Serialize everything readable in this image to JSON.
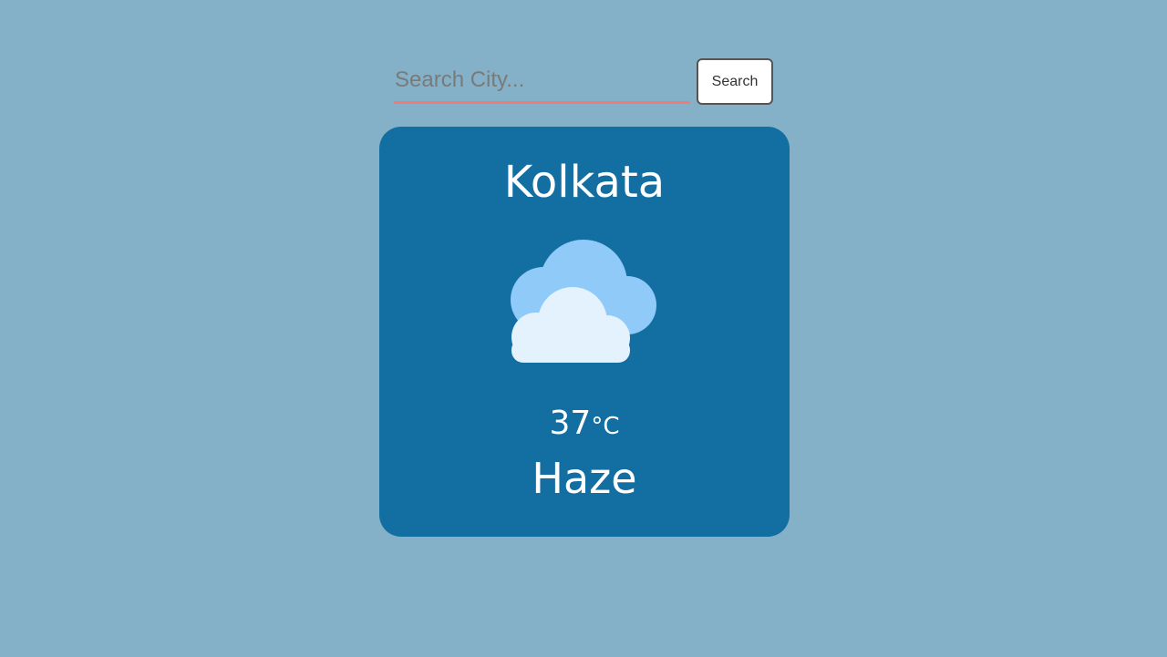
{
  "search": {
    "placeholder": "Search City...",
    "value": "",
    "button_label": "Search"
  },
  "weather": {
    "city": "Kolkata",
    "temperature": "37",
    "unit": "°C",
    "condition": "Haze",
    "icon": "cloudy-icon"
  },
  "colors": {
    "background": "#84b1c8",
    "card": "#136ea1",
    "input_underline": "#f07a7a",
    "cloud_back": "#90caf9",
    "cloud_front": "#e3f2fd"
  }
}
